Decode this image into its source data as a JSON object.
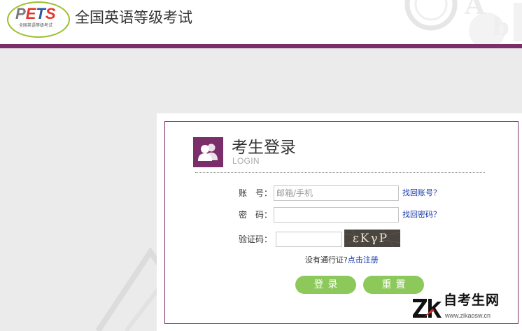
{
  "header": {
    "logo": {
      "mark": [
        "P",
        "E",
        "T",
        "S"
      ],
      "subtitle": "全国英语等级考试"
    },
    "title": "全国英语等级考试"
  },
  "login": {
    "title": "考生登录",
    "subtitle": "LOGIN",
    "icon": "users-icon",
    "account": {
      "label": "账　号：",
      "placeholder": "邮箱/手机",
      "value": "",
      "recover_link": "找回账号？"
    },
    "password": {
      "label": "密　码：",
      "value": "",
      "recover_link": "找回密码？"
    },
    "captcha": {
      "label": "验证码：",
      "value": "",
      "image_text": "εKγP"
    },
    "register": {
      "question": "没有通行证?",
      "link": "点击注册"
    },
    "buttons": {
      "login": "登录",
      "reset": "重置"
    }
  },
  "watermark": {
    "title": "自考生网",
    "url": "www.zikaosw.cn"
  },
  "colors": {
    "brand_purple": "#7a2e6a",
    "button_green": "#8cc85a",
    "link_blue": "#1a3aa8",
    "page_bg": "#ebebeb"
  }
}
